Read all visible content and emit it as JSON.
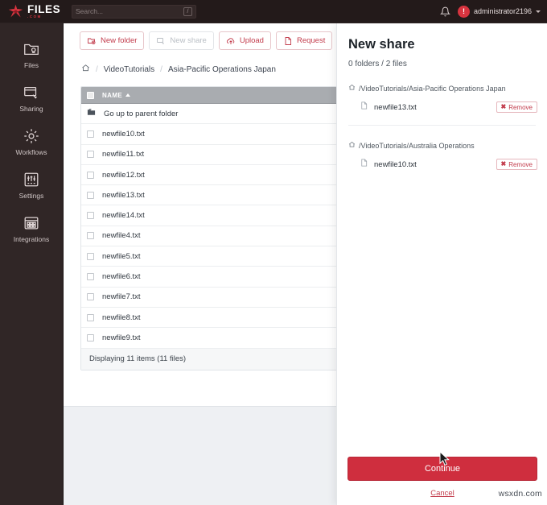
{
  "topbar": {
    "logo_name": "FILES",
    "logo_suffix": ".COM",
    "search_placeholder": "Search...",
    "search_shortcut": "/",
    "bell_icon": "bell-icon",
    "avatar_initial": "!",
    "user_name": "administrator2196"
  },
  "sidebar": {
    "items": [
      {
        "label": "Files",
        "icon": "files-icon"
      },
      {
        "label": "Sharing",
        "icon": "sharing-icon"
      },
      {
        "label": "Workflows",
        "icon": "gear-icon"
      },
      {
        "label": "Settings",
        "icon": "sliders-icon"
      },
      {
        "label": "Integrations",
        "icon": "grid-icon"
      }
    ]
  },
  "toolbar": {
    "new_folder": "New folder",
    "new_share": "New share",
    "upload": "Upload",
    "request": "Request",
    "link_icon": "link-icon",
    "chevron_icon": "chevron-right-icon"
  },
  "breadcrumb": {
    "home_icon": "home-icon",
    "separator": "/",
    "items": [
      "VideoTutorials",
      "Asia-Pacific Operations Japan"
    ]
  },
  "file_table": {
    "header_name": "NAME",
    "sort_direction": "asc",
    "parent_row": "Go up to parent folder",
    "rows": [
      "newfile10.txt",
      "newfile11.txt",
      "newfile12.txt",
      "newfile13.txt",
      "newfile14.txt",
      "newfile4.txt",
      "newfile5.txt",
      "newfile6.txt",
      "newfile7.txt",
      "newfile8.txt",
      "newfile9.txt"
    ],
    "footer": "Displaying 11 items (11 files)"
  },
  "panel": {
    "title": "New share",
    "count": "0 folders / 2 files",
    "groups": [
      {
        "path": "/VideoTutorials/Asia-Pacific Operations Japan",
        "file": "newfile13.txt",
        "remove_label": "Remove"
      },
      {
        "path": "/VideoTutorials/Australia Operations",
        "file": "newfile10.txt",
        "remove_label": "Remove"
      }
    ],
    "continue_label": "Continue",
    "cancel_label": "Cancel"
  },
  "colors": {
    "brand_red": "#cf2e3e",
    "accent_link": "#c23b4b",
    "sidebar_bg": "#302626",
    "topbar_bg": "#231a1a"
  },
  "watermark": "wsxdn.com"
}
